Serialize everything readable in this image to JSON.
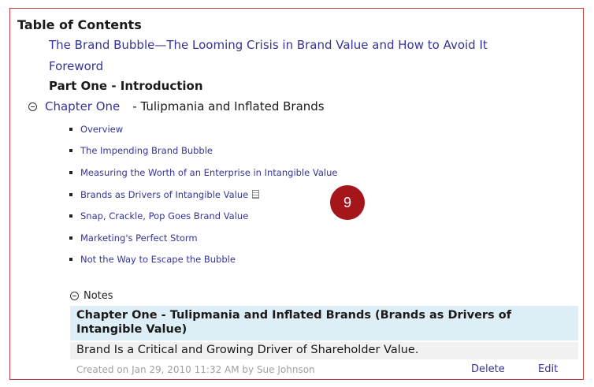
{
  "toc": {
    "title": "Table of Contents",
    "book_title": "The Brand Bubble—The Looming Crisis in Brand Value and How to Avoid It",
    "foreword": "Foreword",
    "part_one": "Part One - Introduction",
    "chapter": {
      "label": "Chapter One",
      "subtitle": "- Tulipmania and Inflated Brands"
    },
    "sections": [
      "Overview",
      "The Impending Brand Bubble",
      "Measuring the Worth of an Enterprise in Intangible Value",
      "Brands as Drivers of Intangible Value",
      "Snap, Crackle, Pop Goes Brand Value",
      "Marketing's Perfect Storm",
      "Not the Way to Escape the Bubble"
    ]
  },
  "badge": "9",
  "notes": {
    "label": "Notes",
    "header": "Chapter One - Tulipmania and Inflated Brands (Brands as Drivers of Intangible Value)",
    "body": "Brand Is a Critical and Growing Driver of Shareholder Value.",
    "meta": "Created on Jan 29, 2010 11:32 AM by Sue Johnson",
    "delete_label": "Delete",
    "edit_label": "Edit"
  },
  "colors": {
    "border": "#c33a3a",
    "link": "#34349a",
    "badge": "#a4161a",
    "note_header_bg": "#deeef6",
    "note_body_bg": "#f1f1f1"
  },
  "icons": [
    "collapse-toggle-icon",
    "bullet-icon",
    "note-icon"
  ]
}
